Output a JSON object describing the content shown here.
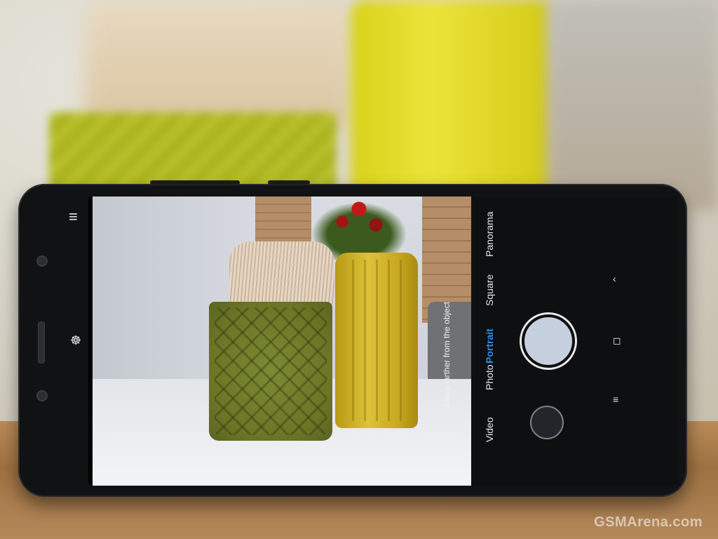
{
  "camera": {
    "modes": [
      "Video",
      "Photo",
      "Portrait",
      "Square",
      "Panorama"
    ],
    "active_mode": "Portrait",
    "hint": "Move farther from the object"
  },
  "icons": {
    "menu": "hamburger-menu-icon",
    "beautify": "three-circles-icon",
    "back": "chevron-icon",
    "home": "square-icon",
    "recents": "hamburger-icon"
  },
  "watermark": "GSMArena.com",
  "colors": {
    "active_mode": "#2f8fe8",
    "shutter": "#c5cfde"
  }
}
